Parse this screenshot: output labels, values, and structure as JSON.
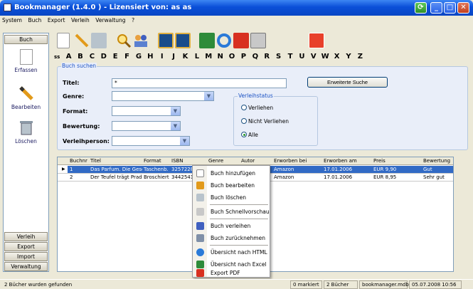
{
  "window": {
    "title": "Bookmanager (1.4.0 ) - Lizensiert von: as as"
  },
  "menu": [
    "System",
    "Buch",
    "Export",
    "Verleih",
    "Verwaltung",
    "?"
  ],
  "left_nav": {
    "header": "Buch",
    "items": [
      "Erfassen",
      "Bearbeiten",
      "Löschen"
    ],
    "bottom_buttons": [
      "Verleih",
      "Export",
      "Import",
      "Verwaltung"
    ]
  },
  "alphabet": [
    "ss",
    "A",
    "B",
    "C",
    "D",
    "E",
    "F",
    "G",
    "H",
    "I",
    "J",
    "K",
    "L",
    "M",
    "N",
    "O",
    "P",
    "Q",
    "R",
    "S",
    "T",
    "U",
    "V",
    "W",
    "X",
    "Y",
    "Z"
  ],
  "search": {
    "legend": "Buch suchen",
    "titel_label": "Titel:",
    "titel_value": "*",
    "genre_label": "Genre:",
    "format_label": "Format:",
    "bewertung_label": "Bewertung:",
    "verleihperson_label": "Verleihperson:",
    "extended_button": "Erweiterte Suche",
    "status": {
      "legend": "Verleihstatus",
      "options": [
        "Verliehen",
        "Nicht Verliehen",
        "Alle"
      ],
      "selected": "Alle"
    }
  },
  "grid": {
    "columns": [
      "Buchnr",
      "Titel",
      "Format",
      "ISBN",
      "Genre",
      "Autor",
      "Erworben bei",
      "Erworben am",
      "Preis",
      "Bewertung"
    ],
    "rows": [
      {
        "marker": "▶",
        "nr": "1",
        "titel": "Das Parfum. Die Gesc",
        "format": "Taschenb.",
        "isbn": "325722803",
        "genre": "",
        "autor": "",
        "bei": "Amazon",
        "am": "17.01.2006",
        "preis": "EUR 9,90",
        "bewertung": "Gut"
      },
      {
        "marker": "",
        "nr": "2",
        "titel": "Der Teufel trägt Prad",
        "format": "Broschiert",
        "isbn": "344254147",
        "genre": "",
        "autor": "",
        "bei": "Amazon",
        "am": "17.01.2006",
        "preis": "EUR 8,95",
        "bewertung": "Sehr gut"
      }
    ]
  },
  "context_menu": [
    "Buch hinzufügen",
    "Buch bearbeiten",
    "Buch löschen",
    "Buch Schnellvorschau",
    "Buch verleihen",
    "Buch zurücknehmen",
    "Übersicht nach HTML",
    "Übersicht nach Excel",
    "Export PDF"
  ],
  "status": {
    "message": "2 Bücher wurden gefunden",
    "marked": "0 markiert",
    "count": "2 Bücher",
    "db": "bookmanager.mdb",
    "datetime": "05.07.2008 10:56"
  },
  "colors": {
    "titlebar": "#0a4fd8",
    "selection": "#316ac5",
    "panel": "#e9eef9"
  }
}
